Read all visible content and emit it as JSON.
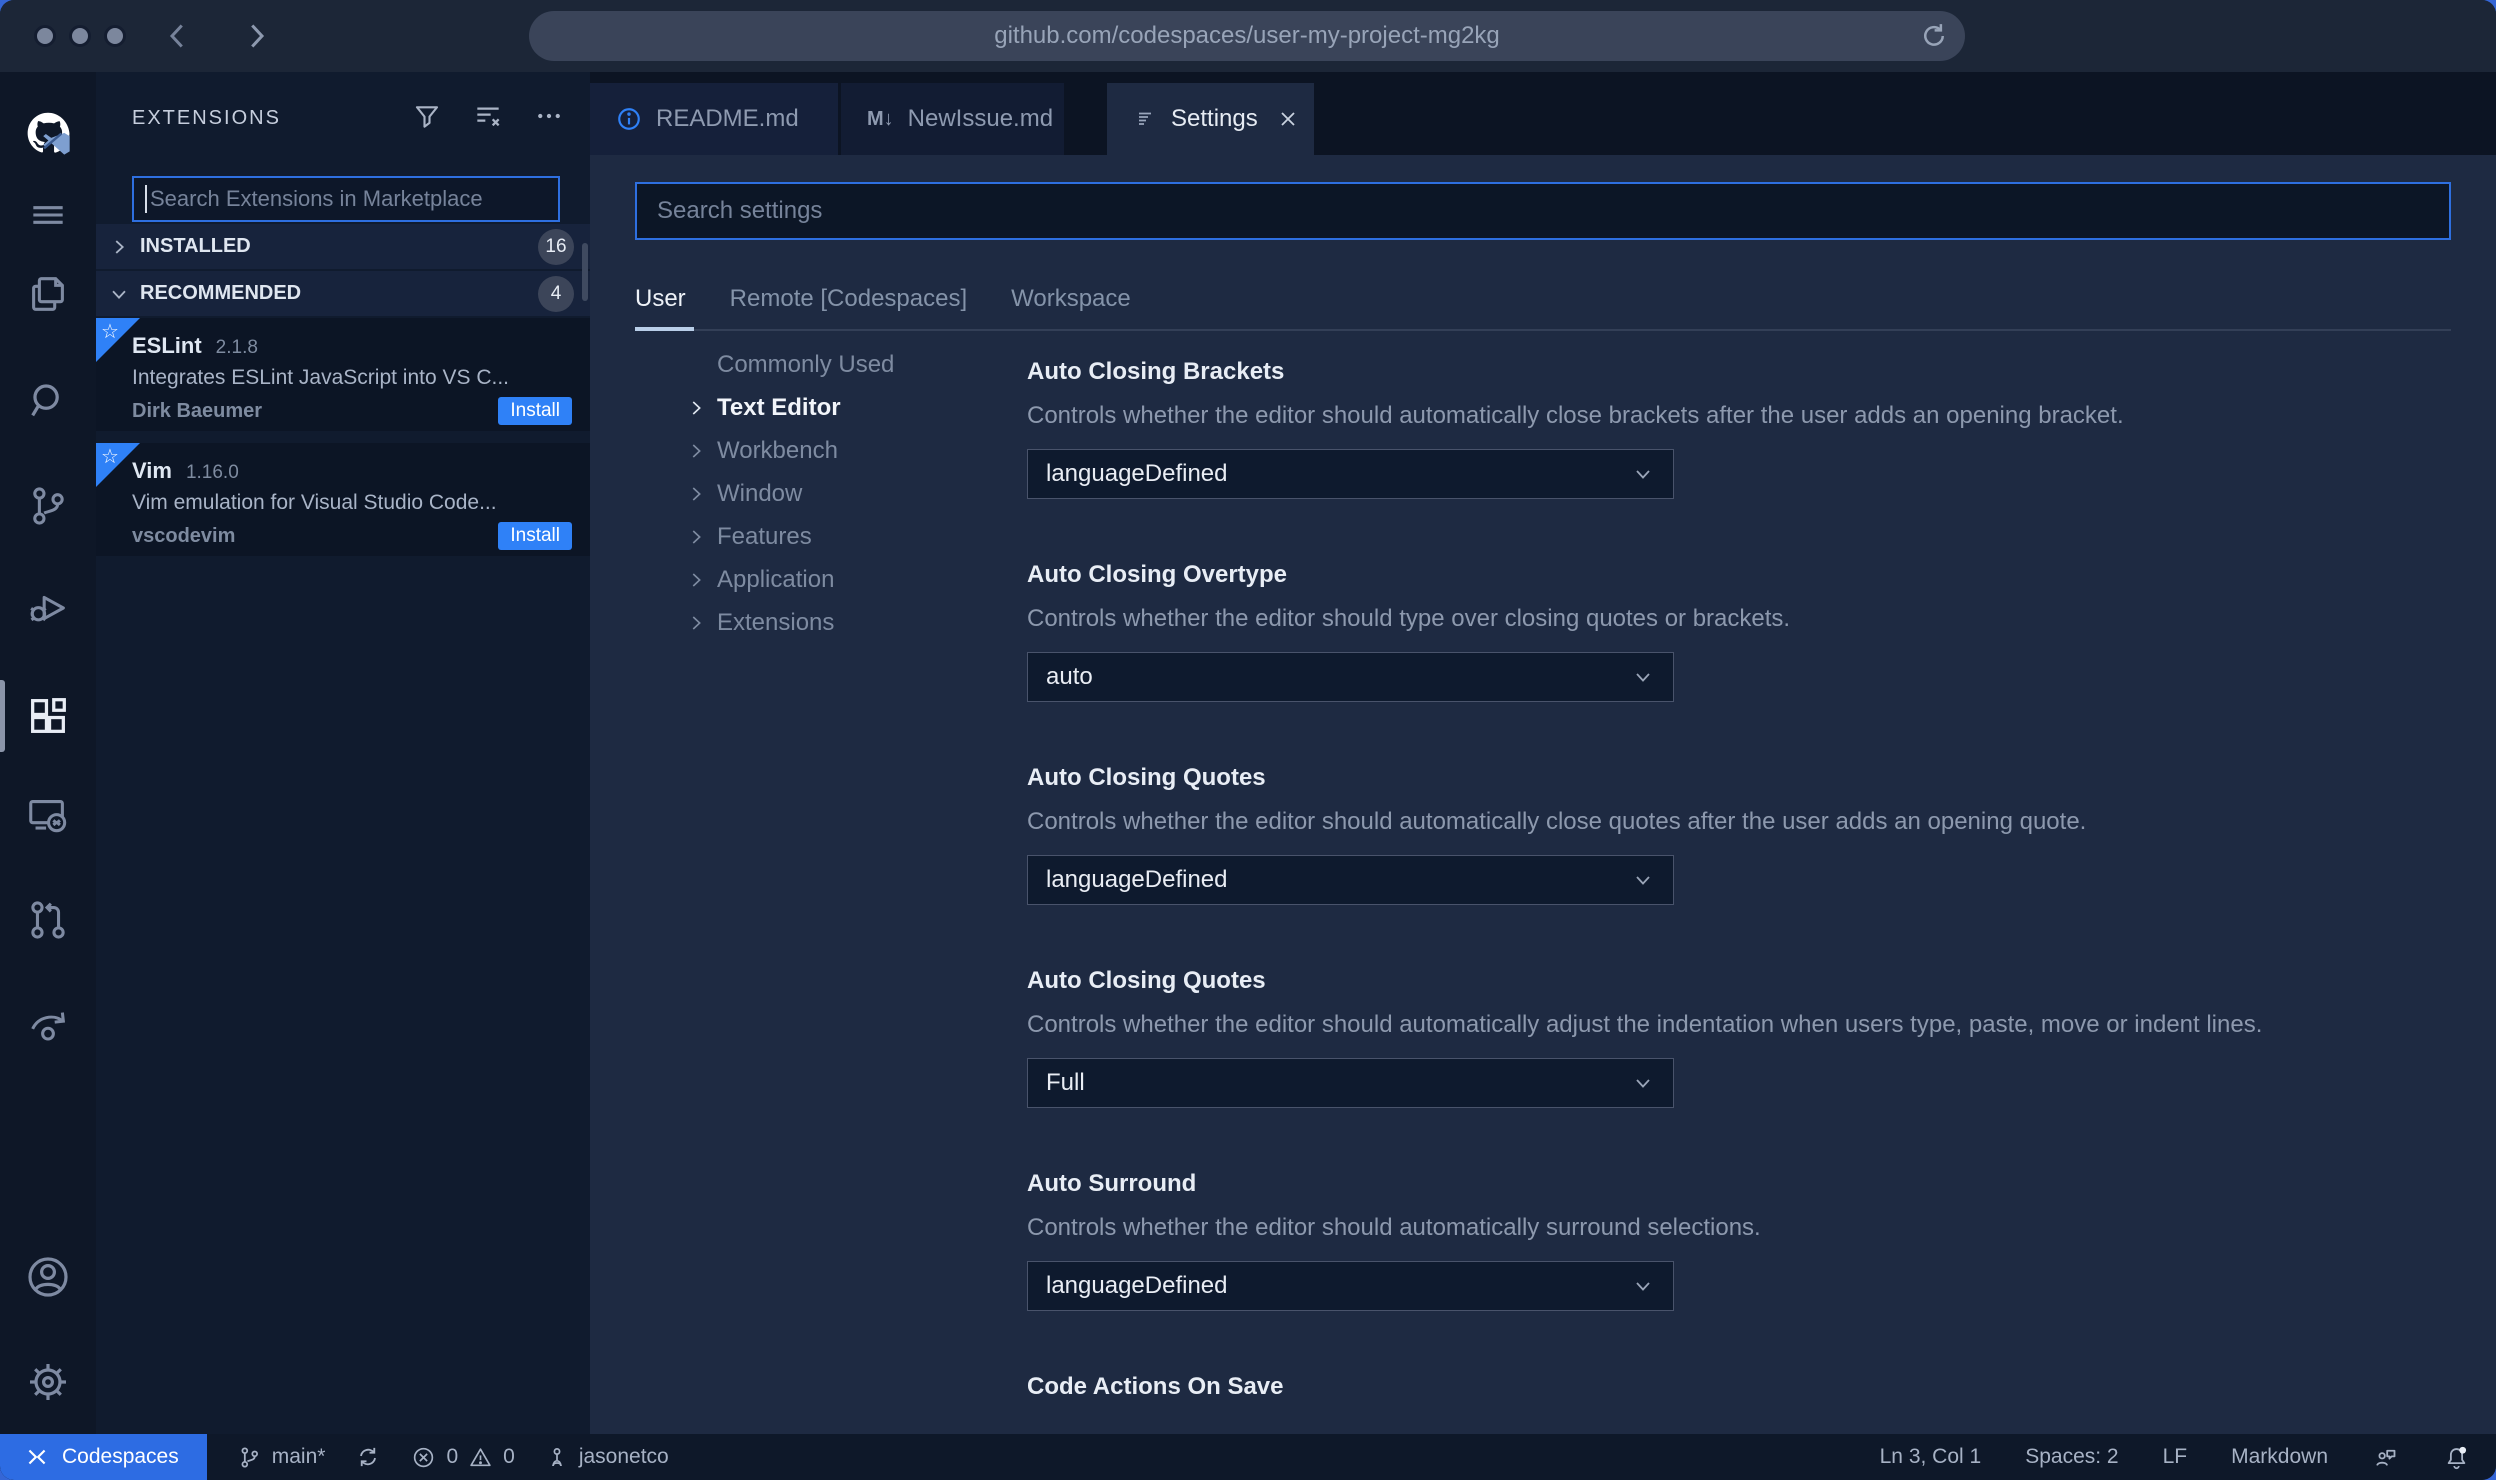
{
  "colors": {
    "accent": "#2f81f7",
    "status_accent": "#2d6ce3",
    "editor_bg": "#1e2a42",
    "sidebar_bg": "#101b2e",
    "activity_bar_bg": "#0e1727",
    "statusbar_bg": "#0e1829"
  },
  "browser": {
    "url": "github.com/codespaces/user-my-project-mg2kg"
  },
  "activity_bar": {
    "icons": [
      "github-vscode-logo",
      "menu",
      "explorer",
      "search",
      "source-control",
      "run-debug",
      "extensions",
      "remote-explorer",
      "pull-request",
      "live-share",
      "account",
      "settings-gear"
    ],
    "active": "extensions"
  },
  "sidebar": {
    "title": "EXTENSIONS",
    "toolbar_icons": [
      "filter-icon",
      "clear-list-icon",
      "more-actions-icon"
    ],
    "search": {
      "placeholder": "Search Extensions in Marketplace"
    },
    "sections": [
      {
        "label": "INSTALLED",
        "count": "16"
      },
      {
        "label": "RECOMMENDED",
        "count": "4"
      }
    ],
    "extensions": [
      {
        "name": "ESLint",
        "version": "2.1.8",
        "description": "Integrates ESLint JavaScript into VS C...",
        "publisher": "Dirk Baeumer",
        "action_label": "Install"
      },
      {
        "name": "Vim",
        "version": "1.16.0",
        "description": "Vim emulation for Visual Studio Code...",
        "publisher": "vscodevim",
        "action_label": "Install"
      }
    ]
  },
  "editor": {
    "tabs": [
      {
        "label": "README.md",
        "icon": "info-icon"
      },
      {
        "label": "NewIssue.md",
        "icon": "markdown-icon",
        "glyph": "M↓"
      },
      {
        "label": "Settings",
        "icon": "settings-list-icon",
        "active": true
      }
    ]
  },
  "settings": {
    "search": {
      "placeholder": "Search settings"
    },
    "scopes": [
      {
        "label": "User",
        "active": true
      },
      {
        "label": "Remote [Codespaces]"
      },
      {
        "label": "Workspace"
      }
    ],
    "toc": [
      {
        "label": "Commonly Used"
      },
      {
        "label": "Text Editor",
        "active": true
      },
      {
        "label": "Workbench"
      },
      {
        "label": "Window"
      },
      {
        "label": "Features"
      },
      {
        "label": "Application"
      },
      {
        "label": "Extensions"
      }
    ],
    "entries": [
      {
        "title": "Auto Closing Brackets",
        "description": "Controls whether the editor should automatically close brackets after the user adds an opening bracket.",
        "value": "languageDefined"
      },
      {
        "title": "Auto Closing Overtype",
        "description": "Controls whether the editor should type over closing quotes or brackets.",
        "value": "auto"
      },
      {
        "title": "Auto Closing Quotes",
        "description": "Controls whether the editor should automatically close quotes after the user adds an opening quote.",
        "value": "languageDefined"
      },
      {
        "title": "Auto Closing Quotes",
        "description": "Controls whether the editor should automatically adjust the indentation when users type, paste, move or indent lines.",
        "value": "Full"
      },
      {
        "title": "Auto Surround",
        "description": "Controls whether the editor should automatically surround selections.",
        "value": "languageDefined"
      },
      {
        "title": "Code Actions On Save"
      }
    ]
  },
  "status_bar": {
    "remote_label": "Codespaces",
    "branch": "main*",
    "errors": "0",
    "warnings": "0",
    "user": "jasonetco",
    "cursor": "Ln 3, Col 1",
    "indent": "Spaces: 2",
    "eol": "LF",
    "language": "Markdown"
  }
}
